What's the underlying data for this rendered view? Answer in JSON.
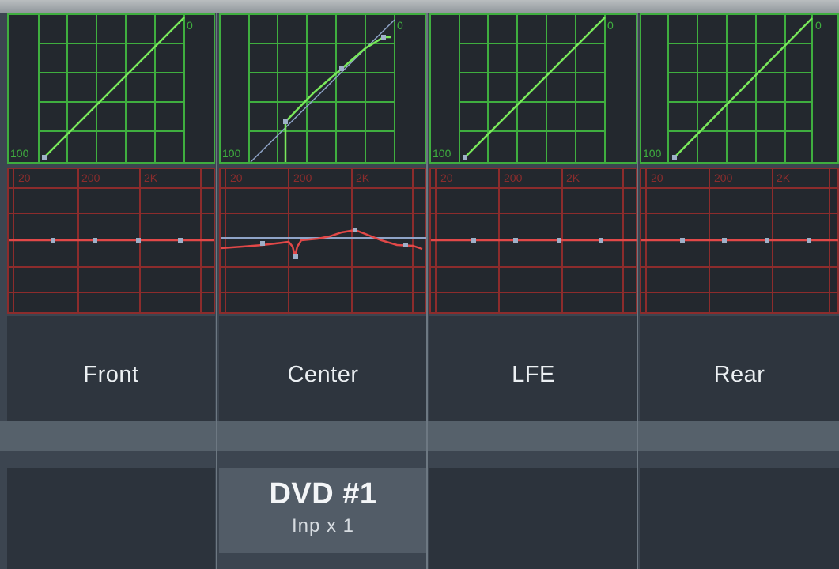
{
  "channels": [
    {
      "name": "Front"
    },
    {
      "name": "Center"
    },
    {
      "name": "LFE"
    },
    {
      "name": "Rear"
    }
  ],
  "dynamics": {
    "top_label": "0",
    "bottom_label": "100"
  },
  "eq": {
    "freq_labels": [
      "20",
      "200",
      "2K"
    ]
  },
  "assignment": {
    "title": "DVD #1",
    "subtitle": "Inp x 1"
  },
  "colors": {
    "dynamics_grid": "#3fae3f",
    "dynamics_curve": "#79e85b",
    "eq_grid": "#8c2c2c",
    "eq_curve": "#e24848",
    "reference_line": "#8fa4c8"
  }
}
